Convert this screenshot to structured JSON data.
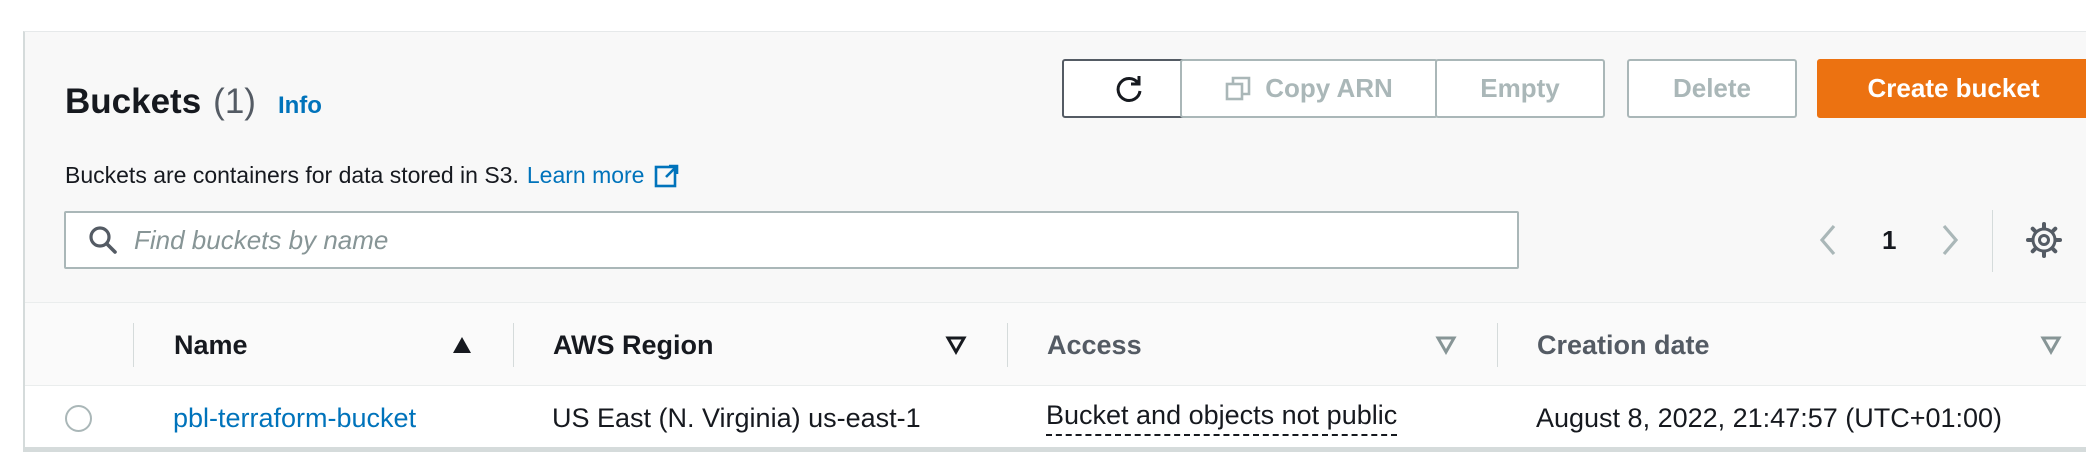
{
  "header": {
    "title": "Buckets",
    "count": "(1)",
    "info_label": "Info",
    "description": "Buckets are containers for data stored in S3.",
    "learn_more_label": "Learn more"
  },
  "toolbar": {
    "copy_arn_label": "Copy ARN",
    "empty_label": "Empty",
    "delete_label": "Delete",
    "create_label": "Create bucket"
  },
  "search": {
    "placeholder": "Find buckets by name"
  },
  "pagination": {
    "current_page": "1"
  },
  "table": {
    "columns": [
      {
        "label": "Name"
      },
      {
        "label": "AWS Region"
      },
      {
        "label": "Access"
      },
      {
        "label": "Creation date"
      }
    ],
    "rows": [
      {
        "name": "pbl-terraform-bucket",
        "region": "US East (N. Virginia) us-east-1",
        "access": "Bucket and objects not public",
        "created": "August 8, 2022, 21:47:57 (UTC+01:00)"
      }
    ]
  },
  "colors": {
    "primary": "#ec7211",
    "link": "#0073bb",
    "disabled": "#aab7b8"
  }
}
